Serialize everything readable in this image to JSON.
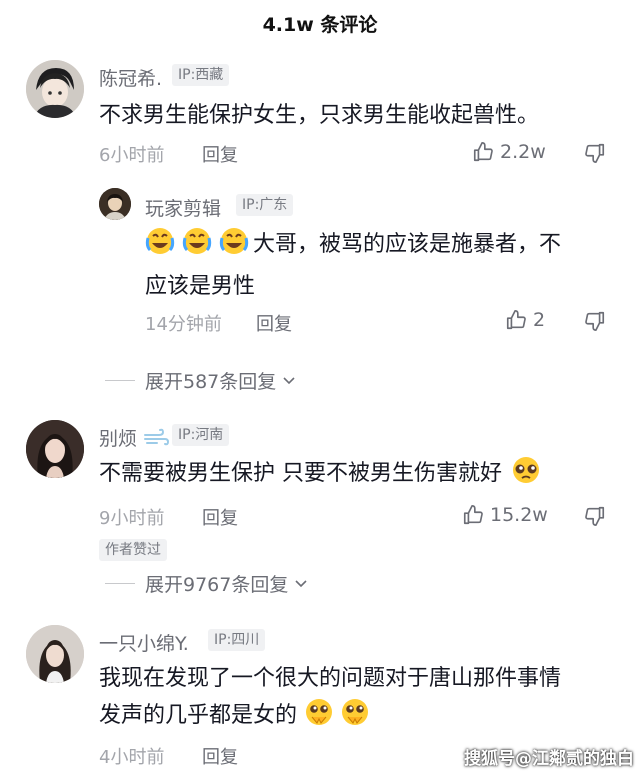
{
  "header": {
    "title": "4.1w 条评论"
  },
  "comments": [
    {
      "username": "陈冠希.",
      "ip": "IP:西藏",
      "text": "不求男生能保护女生，只求男生能收起兽性。",
      "time": "6小时前",
      "reply_label": "回复",
      "likes": "2.2w",
      "avatar_icon": "anime-boy-avatar"
    },
    {
      "username": "别烦",
      "ip": "IP:河南",
      "text": "不需要被男生保护 只要不被男生伤害就好",
      "time": "9小时前",
      "reply_label": "回复",
      "likes": "15.2w",
      "author_tag": "作者赞过",
      "expand": "展开9767条回复",
      "avatar_icon": "woman-photo-avatar",
      "name_icon": "wind-icon",
      "trailing_emoji": "pleading-face-emoji"
    },
    {
      "username": "一只小绵Y.",
      "ip": "IP:四川",
      "text_line1": "我现在发现了一个很大的问题对于唐山那件事情",
      "text_line2": "发声的几乎都是女的",
      "time": "4小时前",
      "reply_label": "回复",
      "avatar_icon": "woman-photo-avatar",
      "trailing_emoji": "pleading-praying-emoji"
    }
  ],
  "replies": [
    {
      "username": "玩家剪辑",
      "ip": "IP:广东",
      "text_line1": "大哥，被骂的应该是施暴者，不",
      "text_line2": "应该是男性",
      "time": "14分钟前",
      "reply_label": "回复",
      "likes": "2",
      "expand": "展开587条回复",
      "leading_emoji": "laughing-crying-emoji"
    }
  ],
  "watermark": "搜狐号@江鄰贰的独白"
}
